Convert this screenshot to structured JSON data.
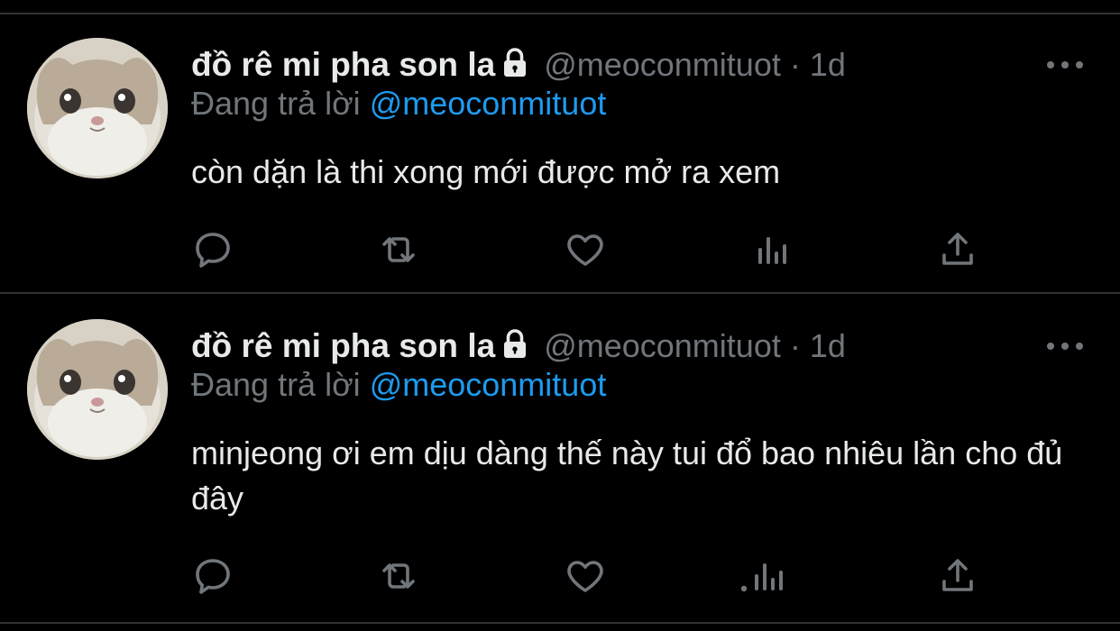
{
  "tweets": [
    {
      "display_name": "đồ rê mi pha son la",
      "handle": "@meoconmituot",
      "separator": "·",
      "time": "1d",
      "reply_prefix": "Đang trả lời",
      "reply_to": "@meoconmituot",
      "text": "còn dặn là thi xong mới được mở ra xem",
      "icons": [
        "reply-icon",
        "retweet-icon",
        "like-icon",
        "analytics-icon",
        "share-icon",
        "more-icon",
        "lock-icon"
      ]
    },
    {
      "display_name": "đồ rê mi pha son la",
      "handle": "@meoconmituot",
      "separator": "·",
      "time": "1d",
      "reply_prefix": "Đang trả lời",
      "reply_to": "@meoconmituot",
      "text": "minjeong ơi em dịu dàng thế này tui đổ bao nhiêu lần cho đủ đây",
      "icons": [
        "reply-icon",
        "retweet-icon",
        "like-icon",
        "analytics-icon",
        "share-icon",
        "more-icon",
        "lock-icon"
      ]
    }
  ],
  "colors": {
    "background": "#000000",
    "text_primary": "#e7e9ea",
    "text_secondary": "#71767b",
    "mention": "#1d9bf0",
    "divider": "#2f3336"
  }
}
